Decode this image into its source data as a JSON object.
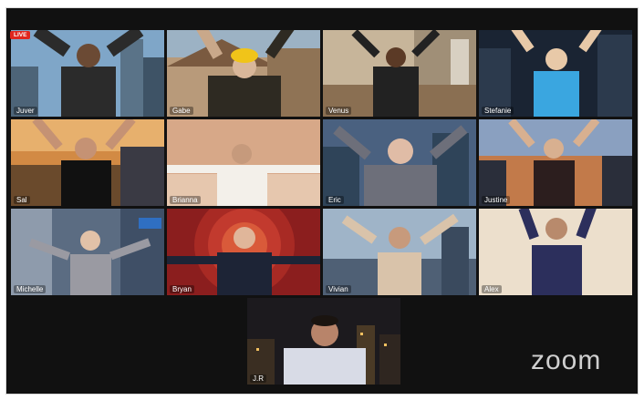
{
  "app": {
    "brand": "zoom",
    "badge": "LIVE"
  },
  "colors": {
    "active_border": "#5cd11d",
    "live_badge": "#e0261f",
    "brand_text": "#cfcfcf"
  },
  "participants": [
    {
      "name": "Juver"
    },
    {
      "name": "Gabe"
    },
    {
      "name": "Venus"
    },
    {
      "name": "Stefanie"
    },
    {
      "name": "Sal"
    },
    {
      "name": "Brianna"
    },
    {
      "name": "Eric"
    },
    {
      "name": "Justine"
    },
    {
      "name": "Michelle"
    },
    {
      "name": "Bryan"
    },
    {
      "name": "Vivian"
    },
    {
      "name": "Alex"
    },
    {
      "name": "J.R"
    }
  ]
}
